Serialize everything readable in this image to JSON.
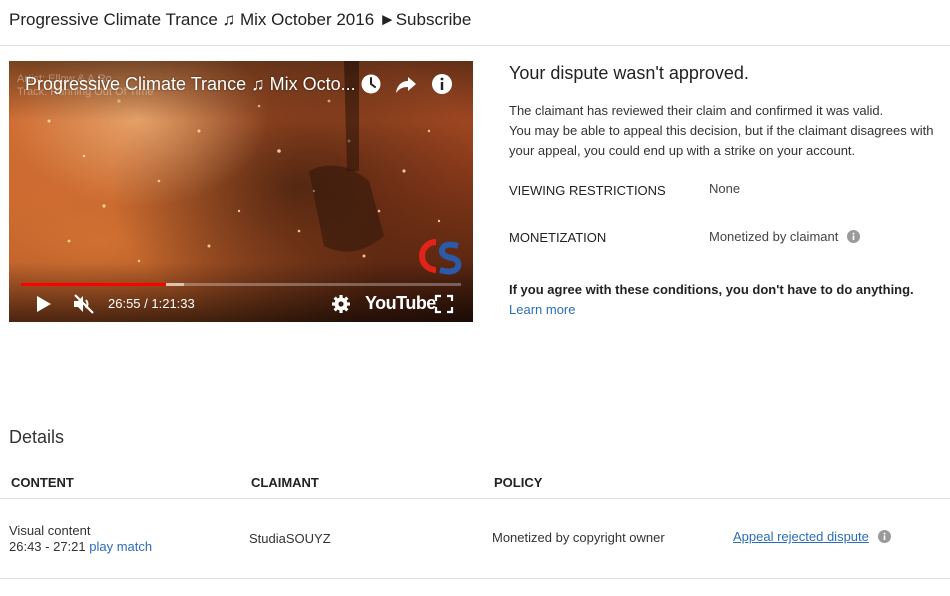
{
  "page": {
    "title": "Progressive Climate Trance ♫ Mix October 2016 ►Subscribe"
  },
  "player": {
    "overlay_title": "Progressive Climate Trance ♫ Mix Octo...",
    "ghost_line_1": "Artist: Ellow & A.Ro",
    "ghost_line_2": "Track: Running Out Of Time",
    "time": "26:55 / 1:21:33",
    "brand_word": "YouTube",
    "progress_played": 0.33,
    "progress_buffered": 0.37,
    "muted": true,
    "accent_color": "#ff0000",
    "icons": [
      "watch-later-icon",
      "share-icon",
      "info-icon",
      "play-icon",
      "muted-volume-icon",
      "settings-gear-icon",
      "fullscreen-icon",
      "cs-channel-logo"
    ]
  },
  "dispute": {
    "title": "Your dispute wasn't approved.",
    "body_line_1": "The claimant has reviewed their claim and confirmed it was valid.",
    "body_line_2": "You may be able to appeal this decision, but if the claimant disagrees with your appeal, you could end up with a strike on your account.",
    "fields": [
      {
        "label": "VIEWING RESTRICTIONS",
        "value": "None"
      },
      {
        "label": "MONETIZATION",
        "value": "Monetized by claimant"
      }
    ],
    "agree_text": "If you agree with these conditions, you don't have to do anything.",
    "learn_more": "Learn more",
    "link_color": "#2a6ebb"
  },
  "details": {
    "title": "Details",
    "columns": [
      "CONTENT",
      "CLAIMANT",
      "POLICY"
    ],
    "row": {
      "content_type": "Visual content",
      "time_range": "26:43 - 27:21",
      "play_match": "play match",
      "claimant": "StudiaSOUYZ",
      "policy": "Monetized by copyright owner",
      "action": "Appeal rejected dispute"
    }
  }
}
